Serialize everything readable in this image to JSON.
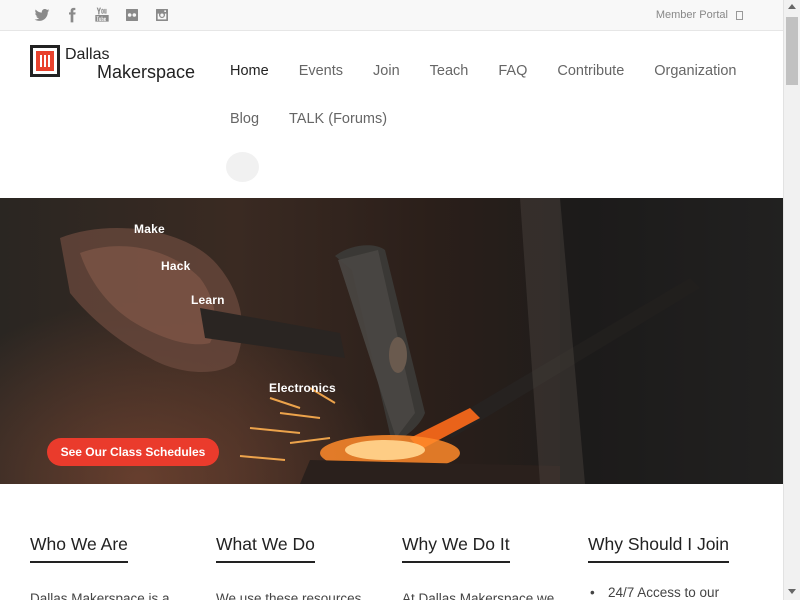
{
  "topbar": {
    "social": [
      "twitter-icon",
      "facebook-icon",
      "youtube-icon",
      "flickr-icon",
      "instagram-icon"
    ],
    "member_portal": "Member Portal"
  },
  "logo": {
    "line1": "Dallas",
    "line2": "Makerspace"
  },
  "nav": {
    "items": [
      {
        "label": "Home",
        "active": true
      },
      {
        "label": "Events"
      },
      {
        "label": "Join"
      },
      {
        "label": "Teach"
      },
      {
        "label": "FAQ"
      },
      {
        "label": "Contribute"
      },
      {
        "label": "Organization"
      },
      {
        "label": "Blog"
      },
      {
        "label": "TALK (Forums)"
      }
    ]
  },
  "hero": {
    "tags": [
      "Make",
      "Hack",
      "Learn",
      "Electronics"
    ],
    "cta": "See Our Class Schedules"
  },
  "columns": [
    {
      "title": "Who We Are",
      "text": "Dallas Makerspace is a"
    },
    {
      "title": "What We Do",
      "text": "We use these resources"
    },
    {
      "title": "Why We Do It",
      "text": "At Dallas Makerspace we"
    },
    {
      "title": "Why Should I Join",
      "bullet": "24/7 Access to our"
    }
  ],
  "colors": {
    "accent": "#ea3b2c",
    "logo_red": "#e8412c"
  }
}
